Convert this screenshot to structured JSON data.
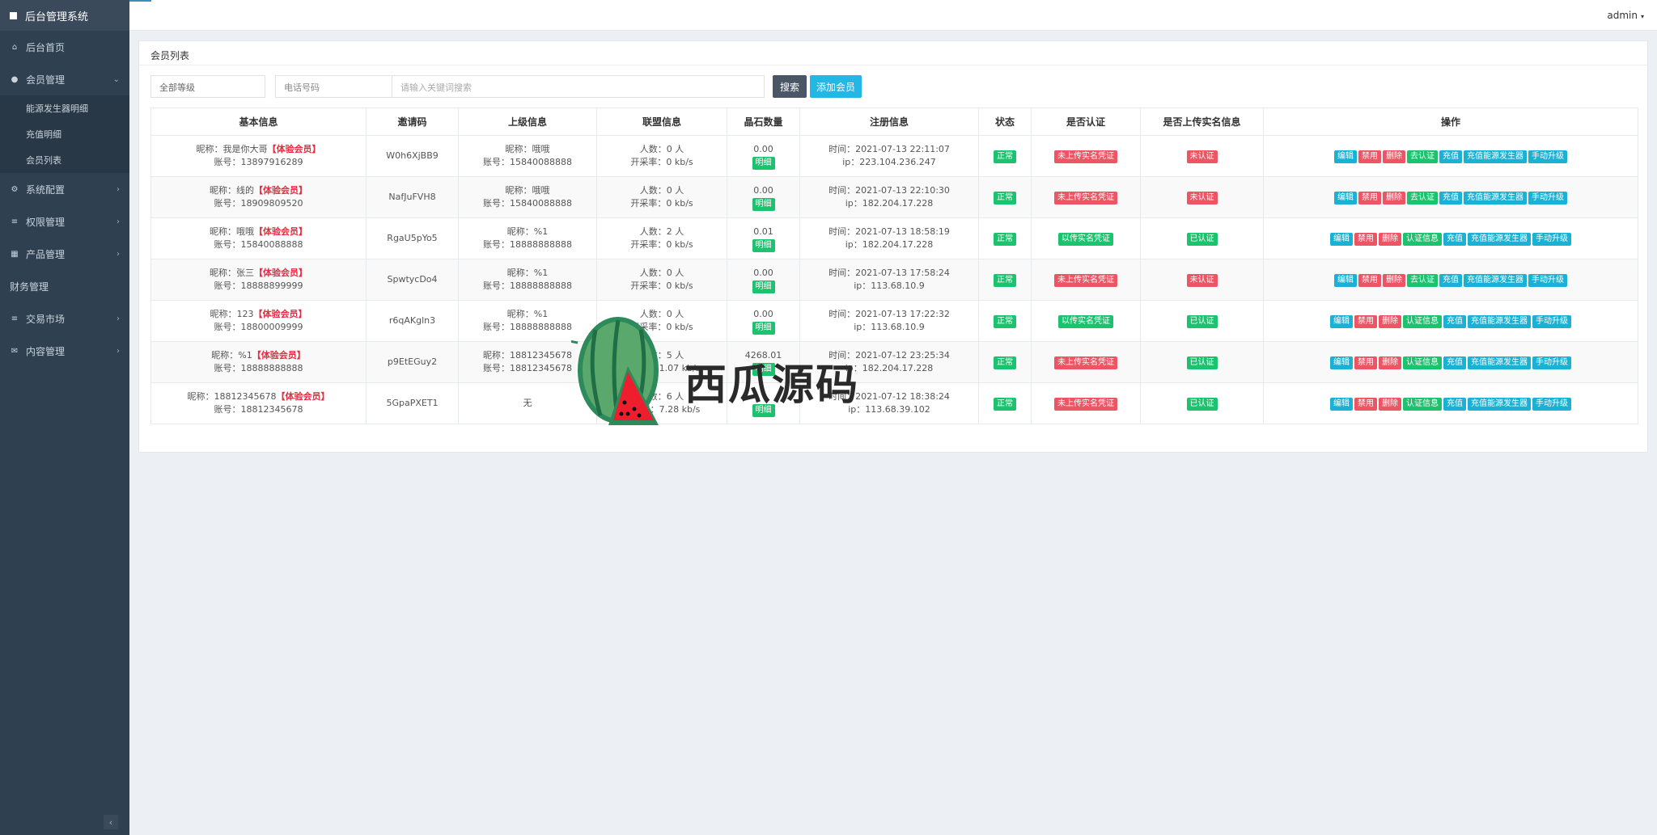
{
  "sidebar": {
    "brand": "后台管理系统",
    "items": [
      {
        "label": "后台首页",
        "icon": "home-icon"
      },
      {
        "label": "会员管理",
        "icon": "user-icon",
        "expanded": true,
        "children": [
          "能源发生器明细",
          "充值明细",
          "会员列表"
        ]
      },
      {
        "label": "系统配置",
        "icon": "gears-icon"
      },
      {
        "label": "权限管理",
        "icon": "list-icon"
      },
      {
        "label": "产品管理",
        "icon": "grid-icon"
      },
      {
        "label": "财务管理",
        "icon": ""
      },
      {
        "label": "交易市场",
        "icon": "bars-icon"
      },
      {
        "label": "内容管理",
        "icon": "envelope-icon"
      }
    ],
    "collapse": "‹"
  },
  "topbar": {
    "user": "admin",
    "caret": "▾"
  },
  "panel": {
    "title": "会员列表"
  },
  "filters": {
    "level": "全部等级",
    "phone": "电话号码",
    "keyword_placeholder": "请输入关键词搜索",
    "search": "搜索",
    "add": "添加会员"
  },
  "table": {
    "headers": [
      "基本信息",
      "邀请码",
      "上级信息",
      "联盟信息",
      "晶石数量",
      "注册信息",
      "状态",
      "是否认证",
      "是否上传实名信息",
      "操作"
    ],
    "detail_label": "明细",
    "vip_label": "【体验会员】",
    "rows": [
      {
        "nick": "昵称：我是你大哥",
        "acct": "账号：13897916289",
        "code": "W0h6XjBB9",
        "up1": "昵称：哦哦",
        "up2": "账号：15840088888",
        "people": "人数：0 人",
        "rate": "开采率：0 kb/s",
        "crystal": "0.00",
        "time": "时间：2021-07-13 22:11:07",
        "ip": "ip：223.104.236.247",
        "status": "正常",
        "real": "未上传实名凭证",
        "real_ok": false,
        "auth": "未认证",
        "auth_ok": false,
        "ops": [
          "编辑",
          "禁用",
          "删除",
          "去认证",
          "充值",
          "充值能源发生器",
          "手动升级"
        ]
      },
      {
        "nick": "昵称：线的",
        "acct": "账号：18909809520",
        "code": "NafJuFVH8",
        "up1": "昵称：哦哦",
        "up2": "账号：15840088888",
        "people": "人数：0 人",
        "rate": "开采率：0 kb/s",
        "crystal": "0.00",
        "time": "时间：2021-07-13 22:10:30",
        "ip": "ip：182.204.17.228",
        "status": "正常",
        "real": "未上传实名凭证",
        "real_ok": false,
        "auth": "未认证",
        "auth_ok": false,
        "ops": [
          "编辑",
          "禁用",
          "删除",
          "去认证",
          "充值",
          "充值能源发生器",
          "手动升级"
        ]
      },
      {
        "nick": "昵称：哦哦",
        "acct": "账号：15840088888",
        "code": "RgaU5pYo5",
        "up1": "昵称：%1",
        "up2": "账号：18888888888",
        "people": "人数：2 人",
        "rate": "开采率：0 kb/s",
        "crystal": "0.01",
        "time": "时间：2021-07-13 18:58:19",
        "ip": "ip：182.204.17.228",
        "status": "正常",
        "real": "以传实名凭证",
        "real_ok": true,
        "auth": "已认证",
        "auth_ok": true,
        "ops": [
          "编辑",
          "禁用",
          "删除",
          "认证信息",
          "充值",
          "充值能源发生器",
          "手动升级"
        ]
      },
      {
        "nick": "昵称：张三",
        "acct": "账号：18888899999",
        "code": "SpwtycDo4",
        "up1": "昵称：%1",
        "up2": "账号：18888888888",
        "people": "人数：0 人",
        "rate": "开采率：0 kb/s",
        "crystal": "0.00",
        "time": "时间：2021-07-13 17:58:24",
        "ip": "ip：113.68.10.9",
        "status": "正常",
        "real": "未上传实名凭证",
        "real_ok": false,
        "auth": "未认证",
        "auth_ok": false,
        "ops": [
          "编辑",
          "禁用",
          "删除",
          "去认证",
          "充值",
          "充值能源发生器",
          "手动升级"
        ]
      },
      {
        "nick": "昵称：123",
        "acct": "账号：18800009999",
        "code": "r6qAKgln3",
        "up1": "昵称：%1",
        "up2": "账号：18888888888",
        "people": "人数：0 人",
        "rate": "开采率：0 kb/s",
        "crystal": "0.00",
        "time": "时间：2021-07-13 17:22:32",
        "ip": "ip：113.68.10.9",
        "status": "正常",
        "real": "以传实名凭证",
        "real_ok": true,
        "auth": "已认证",
        "auth_ok": true,
        "ops": [
          "编辑",
          "禁用",
          "删除",
          "认证信息",
          "充值",
          "充值能源发生器",
          "手动升级"
        ]
      },
      {
        "nick": "昵称：%1",
        "acct": "账号：18888888888",
        "code": "p9EtEGuy2",
        "up1": "昵称：18812345678",
        "up2": "账号：18812345678",
        "people": "人数：5 人",
        "rate": "开采率：1.07 kb/s",
        "crystal": "4268.01",
        "time": "时间：2021-07-12 23:25:34",
        "ip": "ip：182.204.17.228",
        "status": "正常",
        "real": "未上传实名凭证",
        "real_ok": false,
        "auth": "已认证",
        "auth_ok": true,
        "ops": [
          "编辑",
          "禁用",
          "删除",
          "认证信息",
          "充值",
          "充值能源发生器",
          "手动升级"
        ]
      },
      {
        "nick": "昵称：18812345678",
        "acct": "账号：18812345678",
        "code": "5GpaPXET1",
        "up1": "无",
        "up2": "",
        "people": "人数：6 人",
        "rate": "开采率：7.28 kb/s",
        "crystal": "",
        "time": "时间：2021-07-12 18:38:24",
        "ip": "ip：113.68.39.102",
        "status": "正常",
        "real": "未上传实名凭证",
        "real_ok": false,
        "auth": "已认证",
        "auth_ok": true,
        "ops": [
          "编辑",
          "禁用",
          "删除",
          "认证信息",
          "充值",
          "充值能源发生器",
          "手动升级"
        ]
      }
    ]
  },
  "watermark": {
    "text": "西瓜源码",
    "icon": "watermelon-logo-icon"
  }
}
